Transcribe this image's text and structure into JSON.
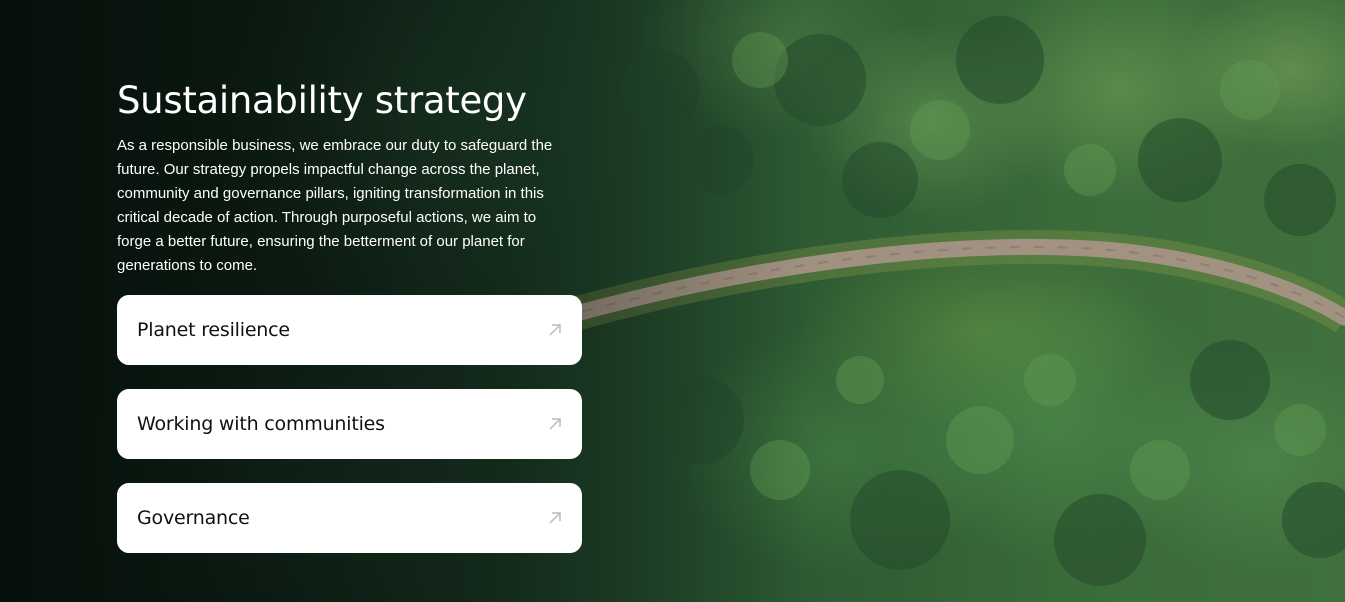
{
  "hero": {
    "title": "Sustainability strategy",
    "description": "As a responsible business, we embrace our duty to safeguard the future. Our strategy propels impactful change across the planet, community and governance pillars, igniting transformation in this critical decade of action. Through purposeful actions, we aim to forge a better future, ensuring the betterment of our planet for generations to come.",
    "background_image": "aerial-forest-road"
  },
  "cards": [
    {
      "label": "Planet resilience",
      "icon": "arrow-up-right-icon"
    },
    {
      "label": "Working with communities",
      "icon": "arrow-up-right-icon"
    },
    {
      "label": "Governance",
      "icon": "arrow-up-right-icon"
    }
  ],
  "colors": {
    "card_background": "#ffffff",
    "card_text": "#111111",
    "arrow": "#b8bec2",
    "title_text": "#ffffff"
  }
}
